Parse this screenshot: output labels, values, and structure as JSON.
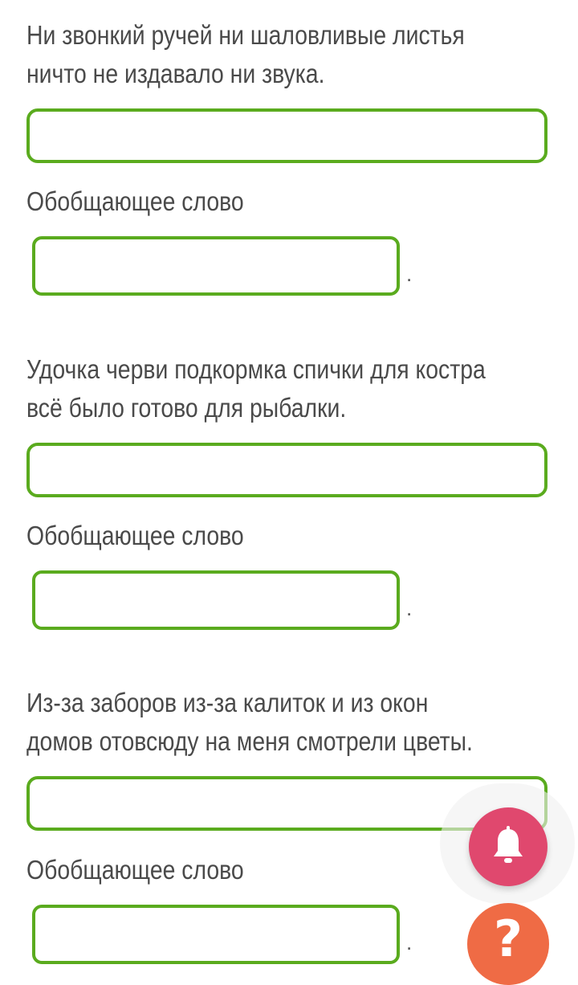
{
  "tasks": [
    {
      "sentence_lines": [
        "Ни звонкий ручей ни шаловливые листья",
        "ничто не издавало ни звука."
      ],
      "answer_value": "",
      "generalizing_label": "Обобщающее слово",
      "generalizing_value": "",
      "trailing_dot": "."
    },
    {
      "sentence_lines": [
        "Удочка черви подкормка спички для костра",
        "всё было готово для рыбалки."
      ],
      "answer_value": "",
      "generalizing_label": "Обобщающее слово",
      "generalizing_value": "",
      "trailing_dot": "."
    },
    {
      "sentence_lines": [
        "Из-за заборов из-за калиток и из окон",
        "домов отовсюду на меня смотрели цветы."
      ],
      "answer_value": "",
      "generalizing_label": "Обобщающее слово",
      "generalizing_value": "",
      "trailing_dot": "."
    }
  ],
  "floating_buttons": {
    "notifications_icon": "bell-icon",
    "help_symbol": "?",
    "help_icon": "question-icon"
  },
  "colors": {
    "box_border": "#5aab1e",
    "text": "#4a4a4a",
    "bell_button": "#e0486e",
    "help_button": "#ef6b45"
  }
}
